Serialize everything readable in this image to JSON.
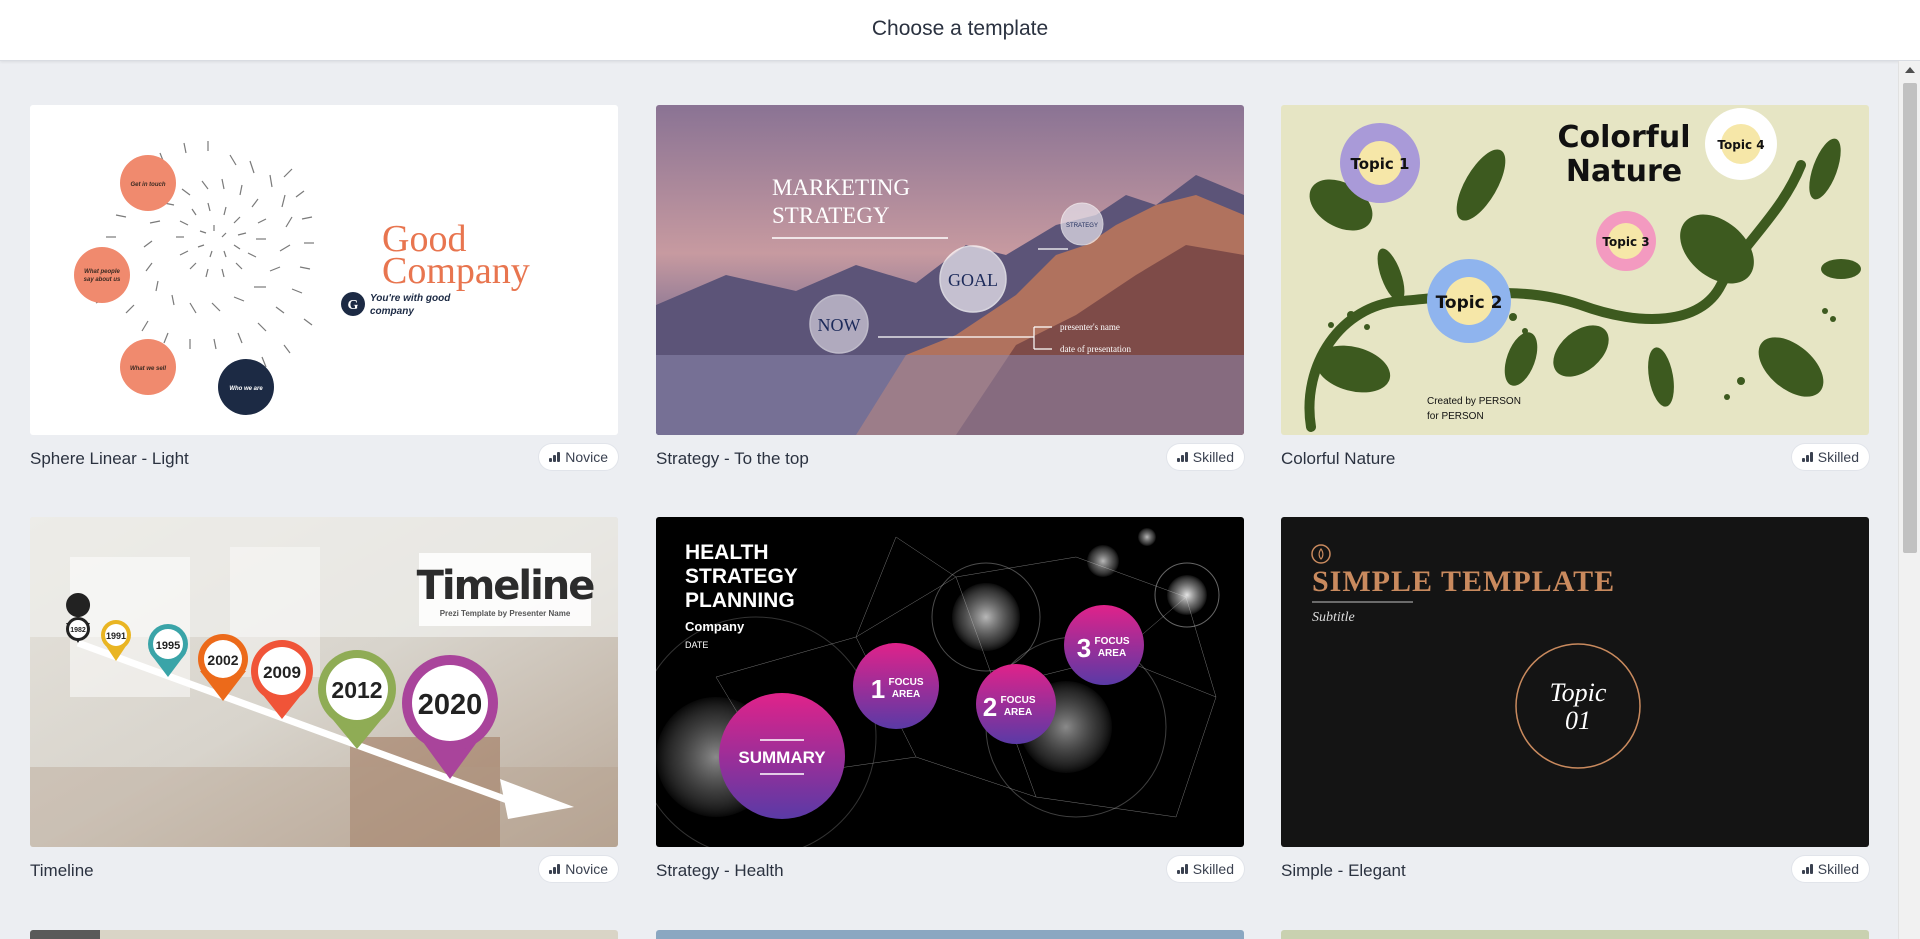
{
  "header": {
    "title": "Choose a template"
  },
  "templates": [
    {
      "name": "Sphere Linear - Light",
      "level": "Novice",
      "thumb": {
        "title1": "Good",
        "title2": "Company",
        "subtitle": "You're with good company",
        "logo": "G",
        "bubbles": [
          "Get in touch",
          "What people say about us",
          "What we sell",
          "Who we are"
        ]
      }
    },
    {
      "name": "Strategy - To the top",
      "level": "Skilled",
      "thumb": {
        "title1": "MARKETING",
        "title2": "STRATEGY",
        "goal": "GOAL",
        "now": "NOW",
        "strategy": "STRATEGY",
        "presenter": "presenter's name",
        "date": "date of presentation"
      }
    },
    {
      "name": "Colorful Nature",
      "level": "Skilled",
      "thumb": {
        "title1": "Colorful",
        "title2": "Nature",
        "topic1": "Topic 1",
        "topic2": "Topic 2",
        "topic3": "Topic 3",
        "topic4": "Topic 4",
        "credit1": "Created by PERSON",
        "credit2": "for PERSON"
      }
    },
    {
      "name": "Timeline",
      "level": "Novice",
      "thumb": {
        "title": "Timeline",
        "subtitle": "Prezi Template by Presenter Name",
        "years": [
          "1982",
          "1991",
          "1995",
          "2002",
          "2009",
          "2012",
          "2020"
        ]
      }
    },
    {
      "name": "Strategy - Health",
      "level": "Skilled",
      "thumb": {
        "title1": "HEALTH",
        "title2": "STRATEGY",
        "title3": "PLANNING",
        "company": "Company",
        "date": "DATE",
        "summary": "SUMMARY",
        "focus_label1": "FOCUS",
        "focus_label2": "AREA",
        "num1": "1",
        "num2": "2",
        "num3": "3"
      }
    },
    {
      "name": "Simple - Elegant",
      "level": "Skilled",
      "thumb": {
        "title": "SIMPLE TEMPLATE",
        "subtitle": "Subtitle",
        "topic1": "Topic",
        "topic2": "01"
      }
    }
  ],
  "colors": {
    "accent_coral": "#f08a6e",
    "navy": "#1c2a44",
    "leaf": "#3d5a1f",
    "nature_bg": "#e6e5c4",
    "magenta": "#d6228a",
    "gold": "#c98a5e"
  },
  "icons": {
    "level": "signal-bars-icon",
    "scroll_up": "chevron-up-icon"
  }
}
